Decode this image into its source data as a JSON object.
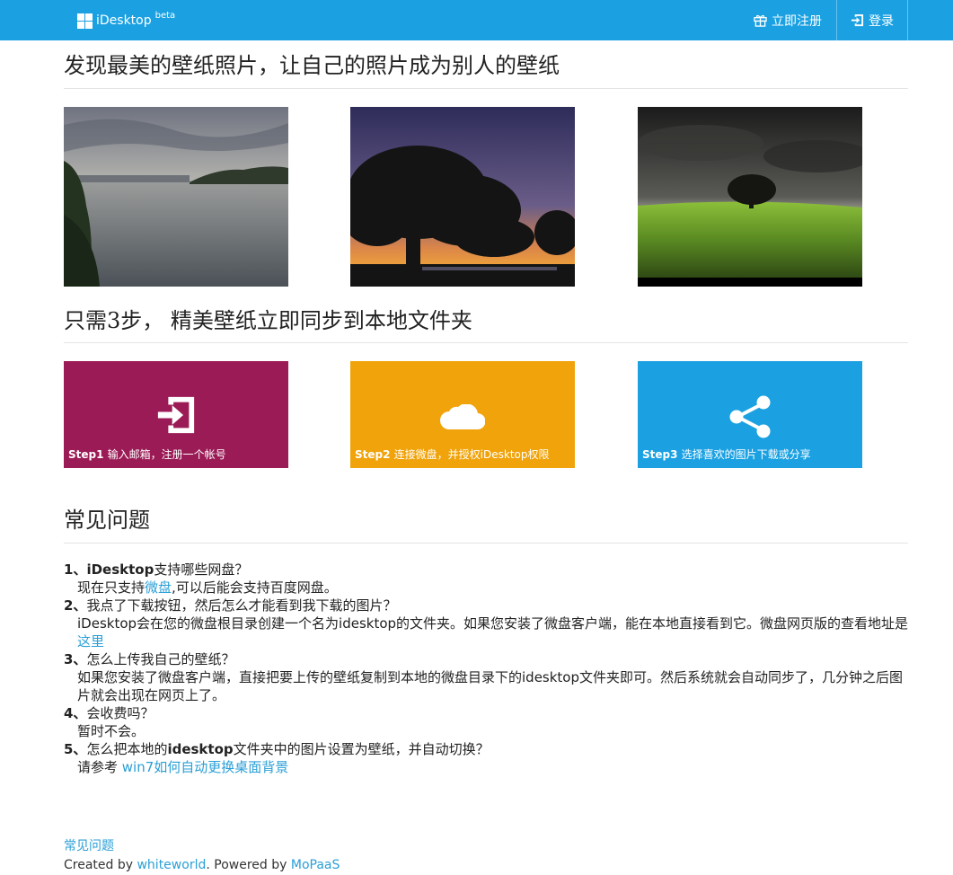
{
  "navbar": {
    "brand": "iDesktop",
    "brand_sup": "beta",
    "register": "立即注册",
    "login": "登录",
    "icons": {
      "brand": "windows-logo-icon",
      "register": "gift-icon",
      "login": "sign-in-icon"
    }
  },
  "section1": {
    "title": "发现最美的壁纸照片，让自己的照片成为别人的壁纸"
  },
  "section2": {
    "title": "只需3步， 精美壁纸立即同步到本地文件夹",
    "steps": [
      {
        "step": "Step1",
        "text": "输入邮箱，注册一个帐号",
        "color": "#9b1b56",
        "icon": "sign-in-icon"
      },
      {
        "step": "Step2",
        "text": "连接微盘，并授权iDesktop权限",
        "color": "#f0a30a",
        "icon": "cloud-icon"
      },
      {
        "step": "Step3",
        "text": "选择喜欢的图片下载或分享",
        "color": "#1ba1e2",
        "icon": "share-icon"
      }
    ]
  },
  "faq": {
    "title": "常见问题",
    "items": [
      {
        "num": "1、",
        "q_bold": "iDesktop",
        "q_rest": "支持哪些网盘？",
        "a_pre": "现在只支持",
        "a_link": "微盘",
        "a_post": ",可以后能会支持百度网盘。"
      },
      {
        "num": "2、",
        "q_rest": "我点了下载按钮，然后怎么才能看到我下载的图片？",
        "a_pre": "iDesktop会在您的微盘根目录创建一个名为idesktop的文件夹。如果您安装了微盘客户端，能在本地直接看到它。微盘网页版的查看地址是 ",
        "a_link": "这里"
      },
      {
        "num": "3、",
        "q_rest": "怎么上传我自己的壁纸？",
        "a_pre": "如果您安装了微盘客户端，直接把要上传的壁纸复制到本地的微盘目录下的idesktop文件夹即可。然后系统就会自动同步了，几分钟之后图片就会出现在网页上了。"
      },
      {
        "num": "4、",
        "q_rest": "会收费吗？",
        "a_pre": "暂时不会。"
      },
      {
        "num": "5、",
        "q_pre": "怎么把本地的",
        "q_bold": "idesktop",
        "q_rest": "文件夹中的图片设置为壁纸，并自动切换？",
        "a_pre": "请参考 ",
        "a_link": "win7如何自动更换桌面背景"
      }
    ]
  },
  "footer": {
    "faq_link": "常见问题",
    "created_by": "Created by ",
    "author": "whiteworld",
    "powered_by": ". Powered by ",
    "platform": "MoPaaS"
  },
  "colors": {
    "primary": "#1ba1e2",
    "link": "#2a9fd6"
  }
}
